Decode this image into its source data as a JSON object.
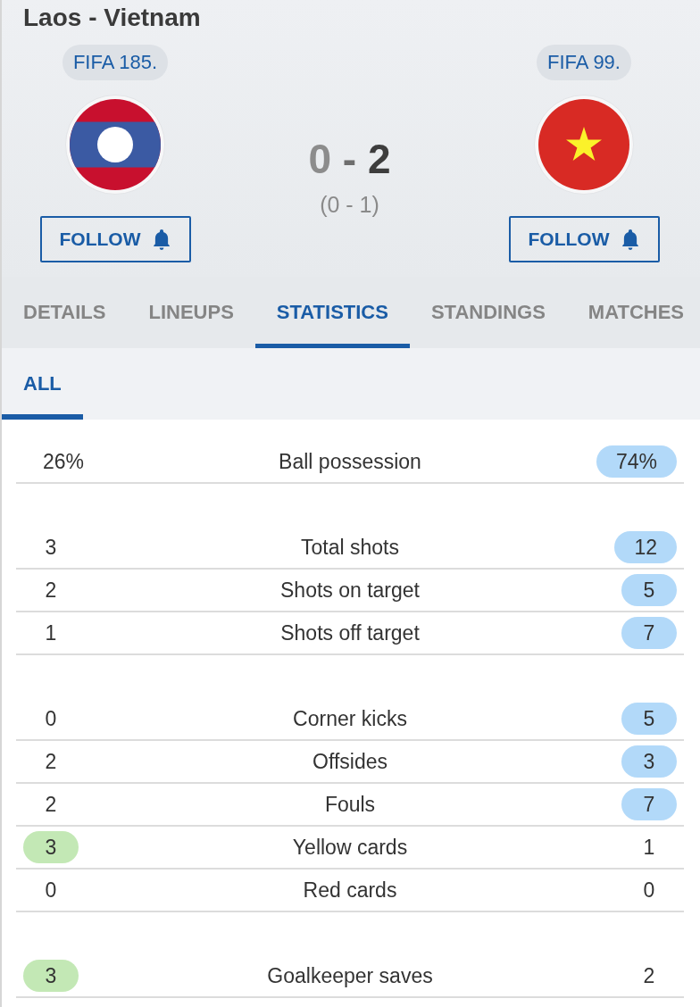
{
  "match": {
    "title": "Laos - Vietnam"
  },
  "teams": [
    {
      "rank": "FIFA 185.",
      "flag": {
        "kind": "laos"
      },
      "follow_label": "FOLLOW"
    },
    {
      "rank": "FIFA 99.",
      "flag": {
        "kind": "vietnam"
      },
      "follow_label": "FOLLOW"
    }
  ],
  "score": {
    "home": {
      "value": "0",
      "leading": false
    },
    "separator": "-",
    "away": {
      "value": "2",
      "leading": true
    },
    "halftime": "(0 - 1)"
  },
  "tabs": [
    {
      "label": "DETAILS",
      "selected": false
    },
    {
      "label": "LINEUPS",
      "selected": false
    },
    {
      "label": "STATISTICS",
      "selected": true
    },
    {
      "label": "STANDINGS",
      "selected": false
    },
    {
      "label": "MATCHES",
      "selected": false
    }
  ],
  "subtabs": [
    {
      "label": "ALL",
      "selected": true
    }
  ],
  "stat_groups": [
    {
      "rows": [
        {
          "label": "Ball possession",
          "home": {
            "value": "26%",
            "highlighted": false
          },
          "away": {
            "value": "74%",
            "highlighted": true
          }
        }
      ]
    },
    {
      "rows": [
        {
          "label": "Total shots",
          "home": {
            "value": "3",
            "highlighted": false
          },
          "away": {
            "value": "12",
            "highlighted": true
          }
        },
        {
          "label": "Shots on target",
          "home": {
            "value": "2",
            "highlighted": false
          },
          "away": {
            "value": "5",
            "highlighted": true
          }
        },
        {
          "label": "Shots off target",
          "home": {
            "value": "1",
            "highlighted": false
          },
          "away": {
            "value": "7",
            "highlighted": true
          }
        }
      ]
    },
    {
      "rows": [
        {
          "label": "Corner kicks",
          "home": {
            "value": "0",
            "highlighted": false
          },
          "away": {
            "value": "5",
            "highlighted": true
          }
        },
        {
          "label": "Offsides",
          "home": {
            "value": "2",
            "highlighted": false
          },
          "away": {
            "value": "3",
            "highlighted": true
          }
        },
        {
          "label": "Fouls",
          "home": {
            "value": "2",
            "highlighted": false
          },
          "away": {
            "value": "7",
            "highlighted": true
          }
        },
        {
          "label": "Yellow cards",
          "home": {
            "value": "3",
            "highlighted": true
          },
          "away": {
            "value": "1",
            "highlighted": false
          }
        },
        {
          "label": "Red cards",
          "home": {
            "value": "0",
            "highlighted": false
          },
          "away": {
            "value": "0",
            "highlighted": false
          }
        }
      ]
    },
    {
      "rows": [
        {
          "label": "Goalkeeper saves",
          "home": {
            "value": "3",
            "highlighted": true
          },
          "away": {
            "value": "2",
            "highlighted": false
          }
        }
      ]
    }
  ]
}
